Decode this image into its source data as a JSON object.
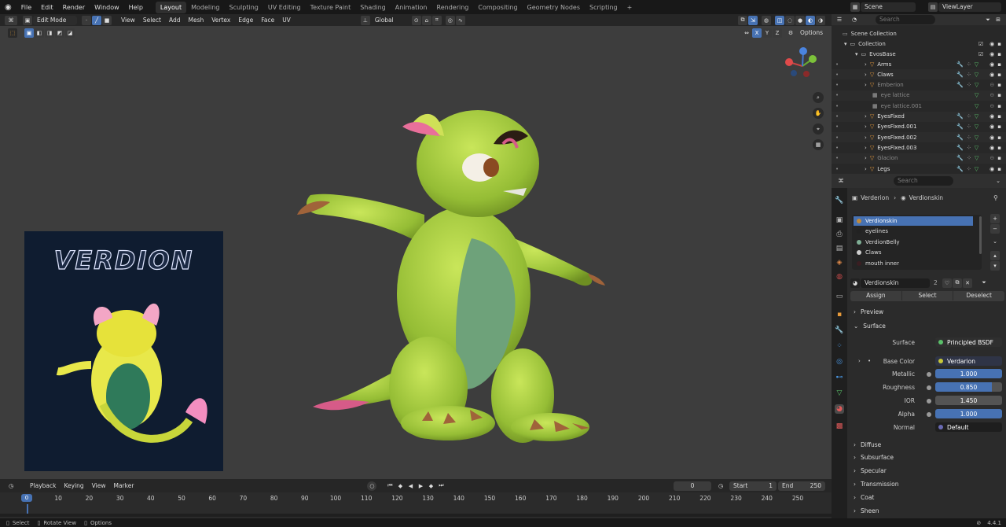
{
  "topbar": {
    "menus": [
      "File",
      "Edit",
      "Render",
      "Window",
      "Help"
    ],
    "workspaces": [
      "Layout",
      "Modeling",
      "Sculpting",
      "UV Editing",
      "Texture Paint",
      "Shading",
      "Animation",
      "Rendering",
      "Compositing",
      "Geometry Nodes",
      "Scripting"
    ],
    "active_workspace": "Layout",
    "add_tab": "+",
    "scene_label": "Scene",
    "viewlayer_label": "ViewLayer"
  },
  "viewport": {
    "mode_label": "Edit Mode",
    "menus": [
      "View",
      "Select",
      "Add",
      "Mesh",
      "Vertex",
      "Edge",
      "Face",
      "UV"
    ],
    "transform_orientation": "Global",
    "axes": [
      "X",
      "Y",
      "Z"
    ],
    "options_label": "Options",
    "gizmo_labels": [
      "X",
      "Y",
      "Z"
    ],
    "background_color": "#3d3d3d",
    "reference_title": "VERDION"
  },
  "outliner": {
    "search_placeholder": "Search",
    "scene_collection": "Scene Collection",
    "collection": "Collection",
    "evosbase": "EvosBase",
    "items": [
      "Arms",
      "Claws",
      "Emberion",
      "eye lattice",
      "eye lattice.001",
      "EyesFixed",
      "EyesFixed.001",
      "EyesFixed.002",
      "EyesFixed.003",
      "Glacion",
      "Legs"
    ]
  },
  "properties": {
    "search_placeholder": "Search",
    "breadcrumb_object": "Verderion",
    "breadcrumb_material": "Verdionskin",
    "slots": [
      "Verdionskin",
      "eyelines",
      "VerdionBelly",
      "Claws",
      "mouth inner"
    ],
    "slot_colors": [
      "#c08a3c",
      "#222222",
      "#7fae95",
      "#cfcfcf",
      "#3a1e22"
    ],
    "material_name": "Verdionskin",
    "material_users": "2",
    "assign": "Assign",
    "select": "Select",
    "deselect": "Deselect",
    "preview_section": "Preview",
    "surface_section": "Surface",
    "surface_label": "Surface",
    "surface_value": "Principled BSDF",
    "base_color_label": "Base Color",
    "base_color_value": "Verdarion",
    "metallic_label": "Metallic",
    "metallic_value": "1.000",
    "roughness_label": "Roughness",
    "roughness_value": "0.850",
    "ior_label": "IOR",
    "ior_value": "1.450",
    "alpha_label": "Alpha",
    "alpha_value": "1.000",
    "normal_label": "Normal",
    "normal_value": "Default",
    "subsections": [
      "Diffuse",
      "Subsurface",
      "Specular",
      "Transmission",
      "Coat",
      "Sheen"
    ]
  },
  "timeline": {
    "menus": [
      "Playback",
      "Keying",
      "View",
      "Marker"
    ],
    "current_frame": "0",
    "start_label": "Start",
    "start_value": "1",
    "end_label": "End",
    "end_value": "250",
    "ticks": [
      "0",
      "10",
      "20",
      "30",
      "40",
      "50",
      "60",
      "70",
      "80",
      "90",
      "100",
      "110",
      "120",
      "130",
      "140",
      "150",
      "160",
      "170",
      "180",
      "190",
      "200",
      "210",
      "220",
      "230",
      "240",
      "250"
    ]
  },
  "statusbar": {
    "select": "Select",
    "rotate_view": "Rotate View",
    "options": "Options",
    "version": "4.4.1"
  }
}
